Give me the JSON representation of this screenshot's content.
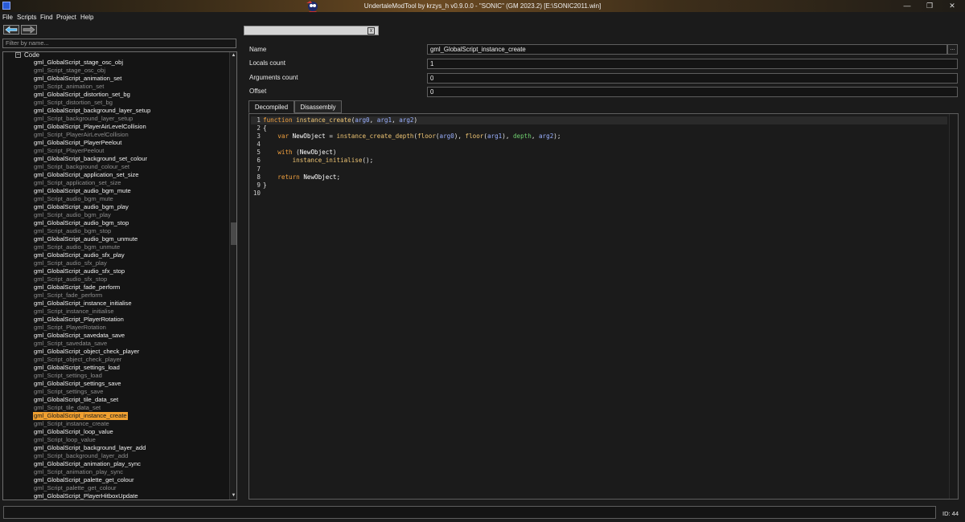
{
  "window": {
    "title": "UndertaleModTool by krzys_h v0.9.0.0 - \"SONIC\" (GM 2023.2) [E:\\SONIC2011.win]",
    "minimize": "—",
    "maximize": "❐",
    "close": "✕"
  },
  "menu": [
    "File",
    "Scripts",
    "Find",
    "Project",
    "Help"
  ],
  "filter": {
    "placeholder": "Filter by name..."
  },
  "tree": {
    "root_label": "Code",
    "items": [
      {
        "label": "gml_GlobalScript_stage_osc_obj",
        "kind": "g"
      },
      {
        "label": "gml_Script_stage_osc_obj",
        "kind": "s"
      },
      {
        "label": "gml_GlobalScript_animation_set",
        "kind": "g"
      },
      {
        "label": "gml_Script_animation_set",
        "kind": "s"
      },
      {
        "label": "gml_GlobalScript_distortion_set_bg",
        "kind": "g"
      },
      {
        "label": "gml_Script_distortion_set_bg",
        "kind": "s"
      },
      {
        "label": "gml_GlobalScript_background_layer_setup",
        "kind": "g"
      },
      {
        "label": "gml_Script_background_layer_setup",
        "kind": "s"
      },
      {
        "label": "gml_GlobalScript_PlayerAirLevelCollision",
        "kind": "g"
      },
      {
        "label": "gml_Script_PlayerAirLevelCollision",
        "kind": "s"
      },
      {
        "label": "gml_GlobalScript_PlayerPeelout",
        "kind": "g"
      },
      {
        "label": "gml_Script_PlayerPeelout",
        "kind": "s"
      },
      {
        "label": "gml_GlobalScript_background_set_colour",
        "kind": "g"
      },
      {
        "label": "gml_Script_background_colour_set",
        "kind": "s"
      },
      {
        "label": "gml_GlobalScript_application_set_size",
        "kind": "g"
      },
      {
        "label": "gml_Script_application_set_size",
        "kind": "s"
      },
      {
        "label": "gml_GlobalScript_audio_bgm_mute",
        "kind": "g"
      },
      {
        "label": "gml_Script_audio_bgm_mute",
        "kind": "s"
      },
      {
        "label": "gml_GlobalScript_audio_bgm_play",
        "kind": "g"
      },
      {
        "label": "gml_Script_audio_bgm_play",
        "kind": "s"
      },
      {
        "label": "gml_GlobalScript_audio_bgm_stop",
        "kind": "g"
      },
      {
        "label": "gml_Script_audio_bgm_stop",
        "kind": "s"
      },
      {
        "label": "gml_GlobalScript_audio_bgm_unmute",
        "kind": "g"
      },
      {
        "label": "gml_Script_audio_bgm_unmute",
        "kind": "s"
      },
      {
        "label": "gml_GlobalScript_audio_sfx_play",
        "kind": "g"
      },
      {
        "label": "gml_Script_audio_sfx_play",
        "kind": "s"
      },
      {
        "label": "gml_GlobalScript_audio_sfx_stop",
        "kind": "g"
      },
      {
        "label": "gml_Script_audio_sfx_stop",
        "kind": "s"
      },
      {
        "label": "gml_GlobalScript_fade_perform",
        "kind": "g"
      },
      {
        "label": "gml_Script_fade_perform",
        "kind": "s"
      },
      {
        "label": "gml_GlobalScript_instance_initialise",
        "kind": "g"
      },
      {
        "label": "gml_Script_instance_initialise",
        "kind": "s"
      },
      {
        "label": "gml_GlobalScript_PlayerRotation",
        "kind": "g"
      },
      {
        "label": "gml_Script_PlayerRotation",
        "kind": "s"
      },
      {
        "label": "gml_GlobalScript_savedata_save",
        "kind": "g"
      },
      {
        "label": "gml_Script_savedata_save",
        "kind": "s"
      },
      {
        "label": "gml_GlobalScript_object_check_player",
        "kind": "g"
      },
      {
        "label": "gml_Script_object_check_player",
        "kind": "s"
      },
      {
        "label": "gml_GlobalScript_settings_load",
        "kind": "g"
      },
      {
        "label": "gml_Script_settings_load",
        "kind": "s"
      },
      {
        "label": "gml_GlobalScript_settings_save",
        "kind": "g"
      },
      {
        "label": "gml_Script_settings_save",
        "kind": "s"
      },
      {
        "label": "gml_GlobalScript_tile_data_set",
        "kind": "g"
      },
      {
        "label": "gml_Script_tile_data_set",
        "kind": "s"
      },
      {
        "label": "gml_GlobalScript_instance_create",
        "kind": "sel"
      },
      {
        "label": "gml_Script_instance_create",
        "kind": "s"
      },
      {
        "label": "gml_GlobalScript_loop_value",
        "kind": "g"
      },
      {
        "label": "gml_Script_loop_value",
        "kind": "s"
      },
      {
        "label": "gml_GlobalScript_background_layer_add",
        "kind": "g"
      },
      {
        "label": "gml_Script_background_layer_add",
        "kind": "s"
      },
      {
        "label": "gml_GlobalScript_animation_play_sync",
        "kind": "g"
      },
      {
        "label": "gml_Script_animation_play_sync",
        "kind": "s"
      },
      {
        "label": "gml_GlobalScript_palette_get_colour",
        "kind": "g"
      },
      {
        "label": "gml_Script_palette_get_colour",
        "kind": "s"
      },
      {
        "label": "gml_GlobalScript_PlayerHitboxUpdate",
        "kind": "g"
      }
    ]
  },
  "doc_tab": {
    "close": "x"
  },
  "props": {
    "name_label": "Name",
    "name_value": "gml_GlobalScript_instance_create",
    "name_button": "...",
    "locals_label": "Locals count",
    "locals_value": "1",
    "args_label": "Arguments count",
    "args_value": "0",
    "offset_label": "Offset",
    "offset_value": "0"
  },
  "tabs": {
    "decompiled": "Decompiled",
    "disassembly": "Disassembly"
  },
  "code": [
    [
      {
        "t": "function ",
        "c": "kw"
      },
      {
        "t": "instance_create",
        "c": "fn"
      },
      {
        "t": "(",
        "c": "pn"
      },
      {
        "t": "arg0",
        "c": "arg"
      },
      {
        "t": ", ",
        "c": "pn"
      },
      {
        "t": "arg1",
        "c": "arg"
      },
      {
        "t": ", ",
        "c": "pn"
      },
      {
        "t": "arg2",
        "c": "arg"
      },
      {
        "t": ")",
        "c": "pn"
      }
    ],
    [
      {
        "t": "{",
        "c": "pn"
      }
    ],
    [
      {
        "t": "    ",
        "c": "pn"
      },
      {
        "t": "var ",
        "c": "kw"
      },
      {
        "t": "NewObject",
        "c": "id"
      },
      {
        "t": " = ",
        "c": "pn"
      },
      {
        "t": "instance_create_depth",
        "c": "fn"
      },
      {
        "t": "(",
        "c": "pn"
      },
      {
        "t": "floor",
        "c": "fn"
      },
      {
        "t": "(",
        "c": "pn"
      },
      {
        "t": "arg0",
        "c": "arg"
      },
      {
        "t": "), ",
        "c": "pn"
      },
      {
        "t": "floor",
        "c": "fn"
      },
      {
        "t": "(",
        "c": "pn"
      },
      {
        "t": "arg1",
        "c": "arg"
      },
      {
        "t": "), ",
        "c": "pn"
      },
      {
        "t": "depth",
        "c": "bi"
      },
      {
        "t": ", ",
        "c": "pn"
      },
      {
        "t": "arg2",
        "c": "arg"
      },
      {
        "t": ");",
        "c": "pn"
      }
    ],
    [],
    [
      {
        "t": "    ",
        "c": "pn"
      },
      {
        "t": "with ",
        "c": "kw"
      },
      {
        "t": "(",
        "c": "pn"
      },
      {
        "t": "NewObject",
        "c": "id"
      },
      {
        "t": ")",
        "c": "pn"
      }
    ],
    [
      {
        "t": "        ",
        "c": "pn"
      },
      {
        "t": "instance_initialise",
        "c": "fn"
      },
      {
        "t": "();",
        "c": "pn"
      }
    ],
    [],
    [
      {
        "t": "    ",
        "c": "pn"
      },
      {
        "t": "return ",
        "c": "kw"
      },
      {
        "t": "NewObject",
        "c": "id"
      },
      {
        "t": ";",
        "c": "pn"
      }
    ],
    [
      {
        "t": "}",
        "c": "pn"
      }
    ],
    []
  ],
  "status": {
    "id_text": "ID: 44"
  }
}
